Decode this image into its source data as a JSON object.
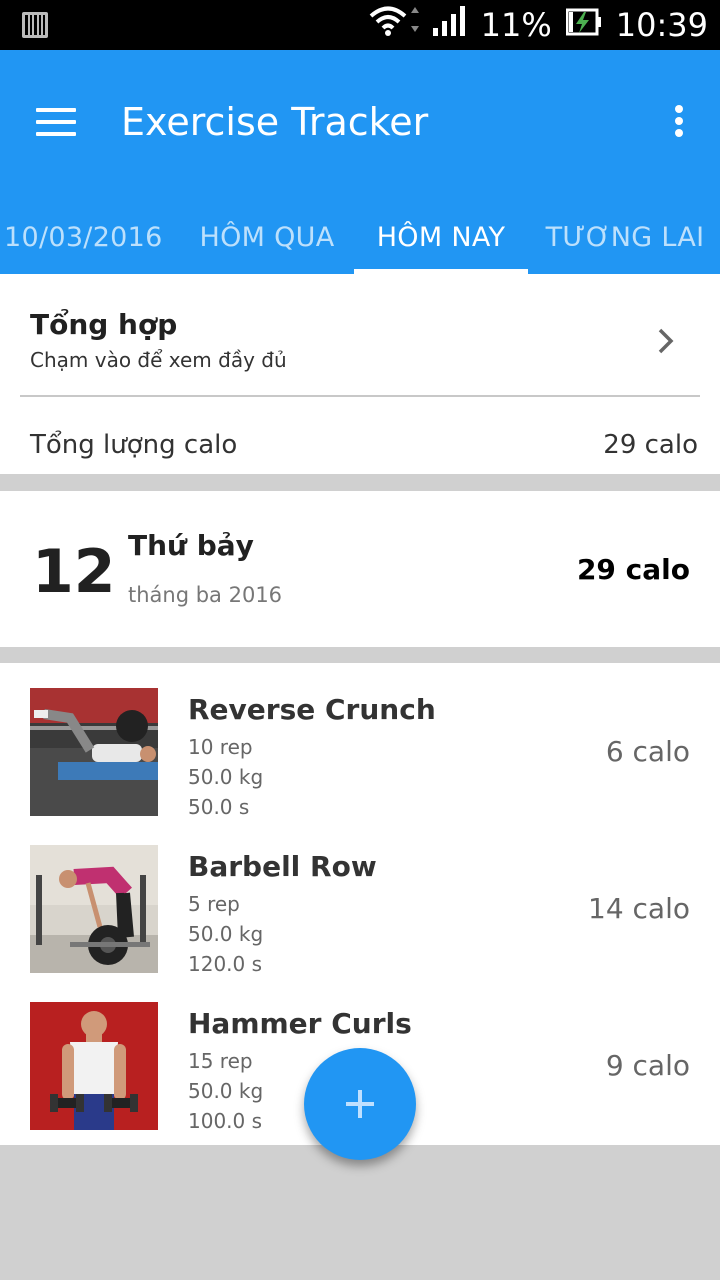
{
  "status_bar": {
    "battery": "11%",
    "time": "10:39",
    "icons": [
      "barcode-icon",
      "wifi-icon",
      "signal-icon",
      "battery-charging-icon"
    ]
  },
  "app_bar": {
    "title": "Exercise Tracker",
    "menu_icon": "hamburger-menu-icon",
    "more_icon": "more-vert-icon"
  },
  "tabs": [
    {
      "label": "10/03/2016",
      "active": false
    },
    {
      "label": "HÔM QUA",
      "active": false
    },
    {
      "label": "HÔM NAY",
      "active": true
    },
    {
      "label": "TƯƠNG LAI",
      "active": false
    }
  ],
  "summary": {
    "title": "Tổng hợp",
    "subtitle": "Chạm vào để xem đầy đủ",
    "total_label": "Tổng lượng calo",
    "total_value": "29 calo"
  },
  "day": {
    "number": "12",
    "weekday": "Thứ bảy",
    "month_year": "tháng ba 2016",
    "calories": "29 calo"
  },
  "exercises": [
    {
      "name": "Reverse Crunch",
      "reps": "10 rep",
      "weight": "50.0 kg",
      "duration": "50.0 s",
      "calories": "6 calo"
    },
    {
      "name": "Barbell Row",
      "reps": "5 rep",
      "weight": "50.0 kg",
      "duration": "120.0 s",
      "calories": "14 calo"
    },
    {
      "name": "Hammer Curls",
      "reps": "15 rep",
      "weight": "50.0 kg",
      "duration": "100.0 s",
      "calories": "9 calo"
    }
  ],
  "fab": {
    "icon": "plus-icon"
  },
  "colors": {
    "primary": "#2196F3",
    "background": "#d0d0d0"
  }
}
